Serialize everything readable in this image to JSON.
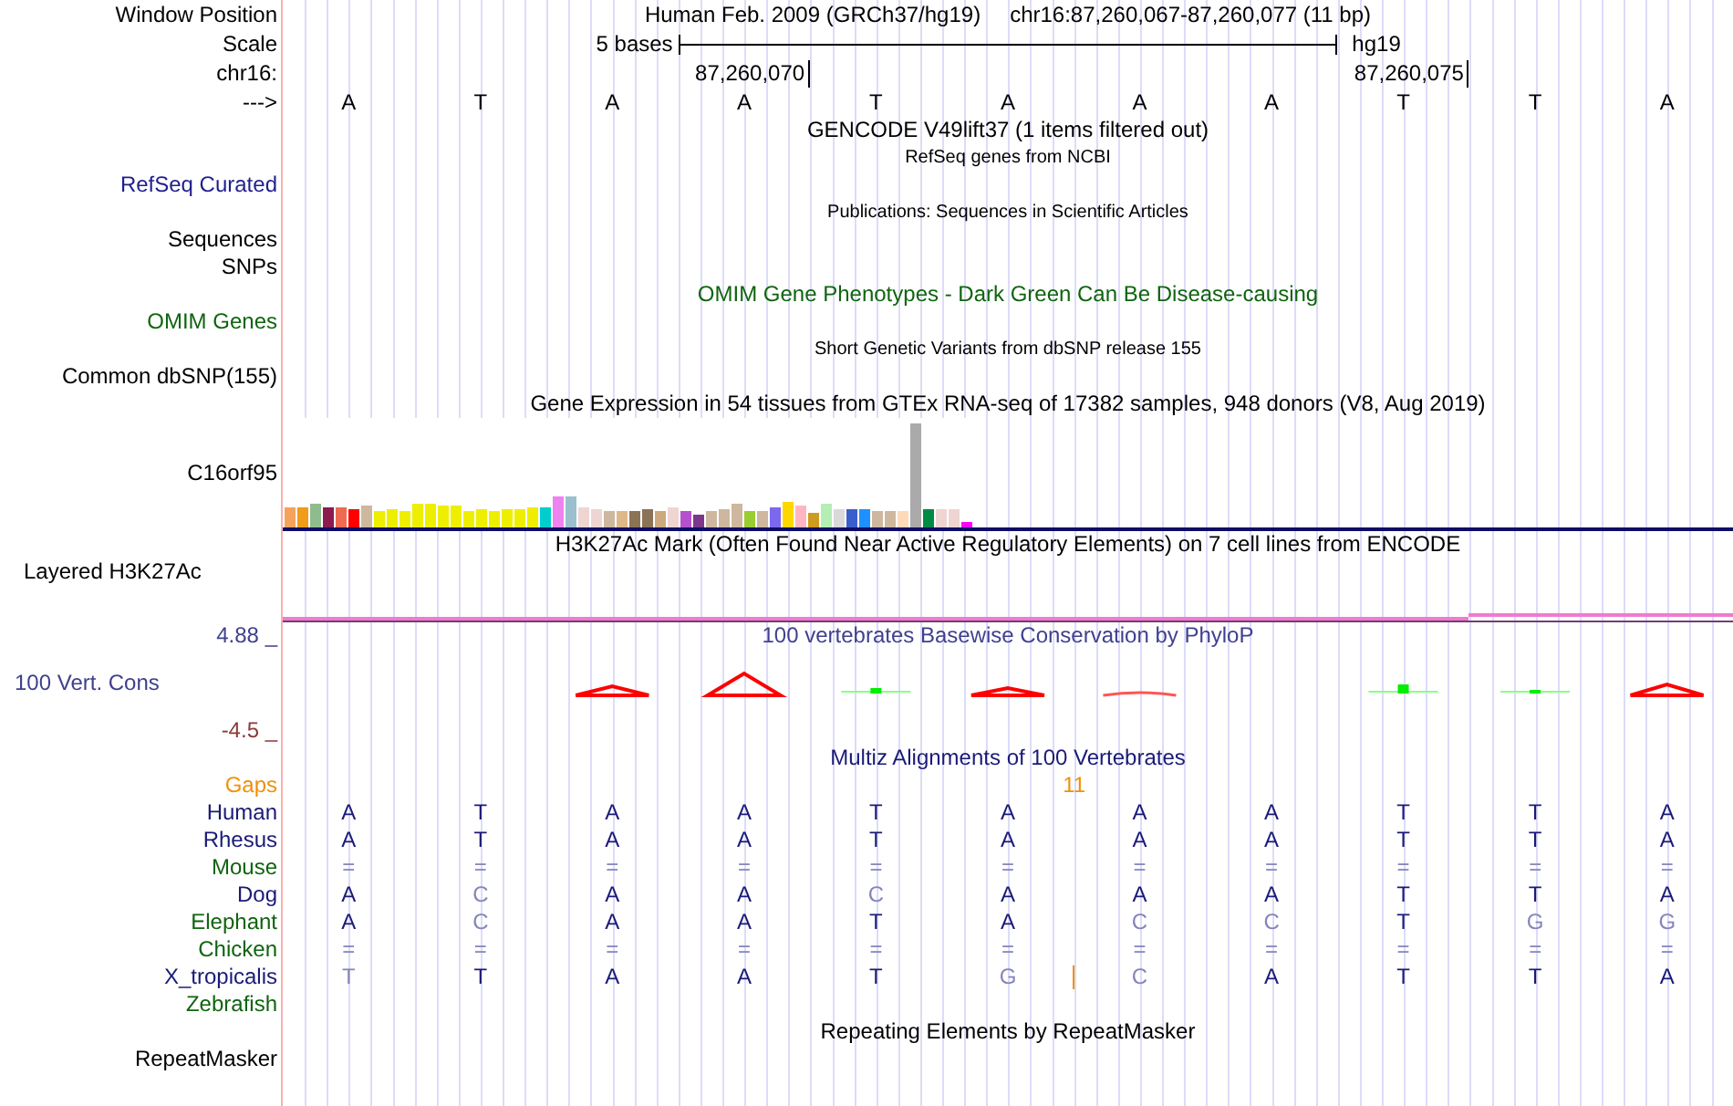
{
  "header": {
    "label": "Window Position",
    "assembly": "Human Feb. 2009 (GRCh37/hg19)",
    "position": "chr16:87,260,067-87,260,077 (11 bp)"
  },
  "scale": {
    "label": "Scale",
    "span": "5 bases",
    "assembly": "hg19"
  },
  "coordinates": {
    "label": "chr16:",
    "ticks": [
      "87,260,070",
      "87,260,075"
    ]
  },
  "strand": {
    "label": "--->",
    "bases": [
      "A",
      "T",
      "A",
      "A",
      "T",
      "A",
      "A",
      "A",
      "T",
      "T",
      "A"
    ]
  },
  "tracks": [
    {
      "kind": "gene",
      "title": "GENCODE V49lift37 (1 items filtered out)"
    },
    {
      "kind": "dense",
      "title": "RefSeq genes from NCBI",
      "labels": [
        {
          "text": "RefSeq Curated",
          "color": "#1f1f8f"
        }
      ]
    },
    {
      "kind": "dense",
      "title": "Publications: Sequences in Scientific Articles",
      "labels": [
        {
          "text": "Sequences",
          "color": "#000000"
        },
        {
          "text": "SNPs",
          "color": "#000000"
        }
      ]
    },
    {
      "kind": "track",
      "title": "OMIM Gene Phenotypes - Dark Green Can Be Disease-causing",
      "color": "#0f640f",
      "labels": [
        {
          "text": "OMIM Genes",
          "color": "#0f640f"
        }
      ]
    },
    {
      "kind": "dense",
      "title": "Short Genetic Variants from dbSNP release 155",
      "labels": [
        {
          "text": "Common dbSNP(155)",
          "color": "#000000"
        }
      ]
    },
    {
      "kind": "bars",
      "title": "Gene Expression in 54 tissues from GTEx RNA-seq of 17382 samples, 948 donors (V8, Aug 2019)",
      "labels": [
        {
          "text": "C16orf95",
          "color": "#000000"
        }
      ]
    },
    {
      "kind": "signal",
      "title": "H3K27Ac Mark (Often Found Near Active Regulatory Elements) on 7 cell lines from ENCODE",
      "labels": [
        {
          "text": "Layered H3K27Ac",
          "color": "#000000"
        }
      ]
    },
    {
      "kind": "wiggle",
      "title": "100 vertebrates Basewise Conservation by PhyloP",
      "color": "#40408f",
      "labels": [
        {
          "text": "100 Vert. Cons",
          "color": "#40408f"
        }
      ],
      "max": "4.88 _",
      "min": "-4.5 _"
    },
    {
      "kind": "alignment",
      "title": "Multiz Alignments of 100 Vertebrates",
      "color": "#1a1a78",
      "gaps": {
        "label": "Gaps",
        "color": "#f0900a"
      },
      "species": [
        {
          "name": "Human",
          "color": "#1a1a78",
          "cells": [
            {
              "kind": "base",
              "text": "A",
              "match": true
            },
            {
              "kind": "base",
              "text": "T",
              "match": true
            },
            {
              "kind": "base",
              "text": "A",
              "match": true
            },
            {
              "kind": "base",
              "text": "A",
              "match": true
            },
            {
              "kind": "base",
              "text": "T",
              "match": true
            },
            {
              "kind": "base",
              "text": "A",
              "match": true
            },
            {
              "kind": "base",
              "text": "A",
              "match": true
            },
            {
              "kind": "base",
              "text": "A",
              "match": true
            },
            {
              "kind": "base",
              "text": "T",
              "match": true
            },
            {
              "kind": "base",
              "text": "T",
              "match": true
            },
            {
              "kind": "base",
              "text": "A",
              "match": true
            }
          ]
        },
        {
          "name": "Rhesus",
          "color": "#1a1a78",
          "cells": [
            {
              "kind": "base",
              "text": "A",
              "match": true
            },
            {
              "kind": "base",
              "text": "T",
              "match": true
            },
            {
              "kind": "base",
              "text": "A",
              "match": true
            },
            {
              "kind": "base",
              "text": "A",
              "match": true
            },
            {
              "kind": "base",
              "text": "T",
              "match": true
            },
            {
              "kind": "base",
              "text": "A",
              "match": true
            },
            {
              "kind": "base",
              "text": "A",
              "match": true
            },
            {
              "kind": "base",
              "text": "A",
              "match": true
            },
            {
              "kind": "base",
              "text": "T",
              "match": true
            },
            {
              "kind": "base",
              "text": "T",
              "match": true
            },
            {
              "kind": "base",
              "text": "A",
              "match": true
            }
          ]
        },
        {
          "name": "Mouse",
          "color": "#0f640f",
          "cells": [
            {
              "kind": "base",
              "text": "=",
              "match": false
            },
            {
              "kind": "base",
              "text": "=",
              "match": false
            },
            {
              "kind": "base",
              "text": "=",
              "match": false
            },
            {
              "kind": "base",
              "text": "=",
              "match": false
            },
            {
              "kind": "base",
              "text": "=",
              "match": false
            },
            {
              "kind": "base",
              "text": "=",
              "match": false
            },
            {
              "kind": "base",
              "text": "=",
              "match": false
            },
            {
              "kind": "base",
              "text": "=",
              "match": false
            },
            {
              "kind": "base",
              "text": "=",
              "match": false
            },
            {
              "kind": "base",
              "text": "=",
              "match": false
            },
            {
              "kind": "base",
              "text": "=",
              "match": false
            }
          ]
        },
        {
          "name": "Dog",
          "color": "#1a1a78",
          "cells": [
            {
              "kind": "base",
              "text": "A",
              "match": true
            },
            {
              "kind": "base",
              "text": "C",
              "match": false
            },
            {
              "kind": "base",
              "text": "A",
              "match": true
            },
            {
              "kind": "base",
              "text": "A",
              "match": true
            },
            {
              "kind": "base",
              "text": "C",
              "match": false
            },
            {
              "kind": "base",
              "text": "A",
              "match": true
            },
            {
              "kind": "base",
              "text": "A",
              "match": true
            },
            {
              "kind": "base",
              "text": "A",
              "match": true
            },
            {
              "kind": "base",
              "text": "T",
              "match": true
            },
            {
              "kind": "base",
              "text": "T",
              "match": true
            },
            {
              "kind": "base",
              "text": "A",
              "match": true
            }
          ]
        },
        {
          "name": "Elephant",
          "color": "#0f640f",
          "cells": [
            {
              "kind": "base",
              "text": "A",
              "match": true
            },
            {
              "kind": "base",
              "text": "C",
              "match": false
            },
            {
              "kind": "base",
              "text": "A",
              "match": true
            },
            {
              "kind": "base",
              "text": "A",
              "match": true
            },
            {
              "kind": "base",
              "text": "T",
              "match": true
            },
            {
              "kind": "base",
              "text": "A",
              "match": true
            },
            {
              "kind": "base",
              "text": "C",
              "match": false
            },
            {
              "kind": "base",
              "text": "C",
              "match": false
            },
            {
              "kind": "base",
              "text": "T",
              "match": true
            },
            {
              "kind": "base",
              "text": "G",
              "match": false
            },
            {
              "kind": "base",
              "text": "G",
              "match": false
            }
          ]
        },
        {
          "name": "Chicken",
          "color": "#0f640f",
          "cells": [
            {
              "kind": "base",
              "text": "=",
              "match": false
            },
            {
              "kind": "base",
              "text": "=",
              "match": false
            },
            {
              "kind": "base",
              "text": "=",
              "match": false
            },
            {
              "kind": "base",
              "text": "=",
              "match": false
            },
            {
              "kind": "base",
              "text": "=",
              "match": false
            },
            {
              "kind": "base",
              "text": "=",
              "match": false
            },
            {
              "kind": "base",
              "text": "=",
              "match": false
            },
            {
              "kind": "base",
              "text": "=",
              "match": false
            },
            {
              "kind": "base",
              "text": "=",
              "match": false
            },
            {
              "kind": "base",
              "text": "=",
              "match": false
            },
            {
              "kind": "base",
              "text": "=",
              "match": false
            }
          ]
        },
        {
          "name": "X_tropicalis",
          "color": "#1a1a78",
          "cells": [
            {
              "kind": "base",
              "text": "T",
              "match": false
            },
            {
              "kind": "base",
              "text": "T",
              "match": true
            },
            {
              "kind": "base",
              "text": "A",
              "match": true
            },
            {
              "kind": "base",
              "text": "A",
              "match": true
            },
            {
              "kind": "base",
              "text": "T",
              "match": true
            },
            {
              "kind": "base",
              "text": "G",
              "match": false
            },
            {
              "kind": "insert",
              "count": "11"
            },
            {
              "kind": "base",
              "text": "C",
              "match": false
            },
            {
              "kind": "base",
              "text": "A",
              "match": true
            },
            {
              "kind": "base",
              "text": "T",
              "match": true
            },
            {
              "kind": "base",
              "text": "T",
              "match": true
            },
            {
              "kind": "base",
              "text": "A",
              "match": true
            }
          ]
        },
        {
          "name": "Zebrafish",
          "color": "#0f640f"
        }
      ]
    },
    {
      "kind": "track",
      "title": "Repeating Elements by RepeatMasker",
      "labels": [
        {
          "text": "RepeatMasker",
          "color": "#000000"
        }
      ]
    }
  ]
}
